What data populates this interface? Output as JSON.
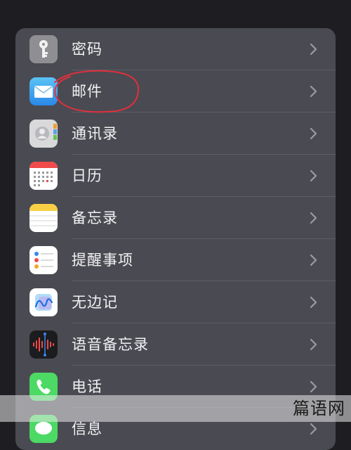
{
  "settings": {
    "items": [
      {
        "label": "密码",
        "icon": "key-icon"
      },
      {
        "label": "邮件",
        "icon": "mail-icon"
      },
      {
        "label": "通讯录",
        "icon": "contacts-icon"
      },
      {
        "label": "日历",
        "icon": "calendar-icon"
      },
      {
        "label": "备忘录",
        "icon": "notes-icon"
      },
      {
        "label": "提醒事项",
        "icon": "reminders-icon"
      },
      {
        "label": "无边记",
        "icon": "freeform-icon"
      },
      {
        "label": "语音备忘录",
        "icon": "voice-memos-icon"
      },
      {
        "label": "电话",
        "icon": "phone-icon"
      },
      {
        "label": "信息",
        "icon": "messages-icon"
      }
    ]
  },
  "watermark": "篇语网",
  "colors": {
    "panel": "#4a4a52",
    "annotation": "#e0303c"
  }
}
